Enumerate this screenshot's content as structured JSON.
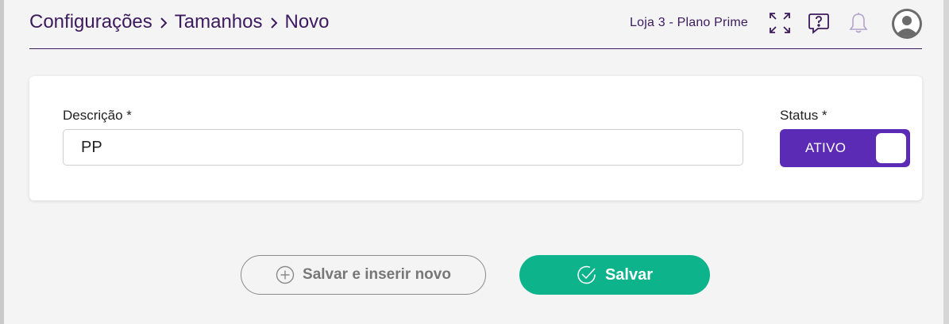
{
  "breadcrumb": {
    "items": [
      "Configurações",
      "Tamanhos",
      "Novo"
    ]
  },
  "header": {
    "store_label": "Loja 3 - Plano Prime",
    "icons": [
      "expand-icon",
      "help-icon",
      "bell-icon",
      "avatar-icon"
    ]
  },
  "form": {
    "description": {
      "label": "Descrição *",
      "value": "PP"
    },
    "status": {
      "label": "Status *",
      "value": "ATIVO",
      "on": true
    }
  },
  "actions": {
    "save_and_new_label": "Salvar e inserir novo",
    "save_label": "Salvar"
  },
  "colors": {
    "brand_dark": "#3c1a5e",
    "toggle_on": "#5b2bb5",
    "primary": "#0db38b"
  }
}
